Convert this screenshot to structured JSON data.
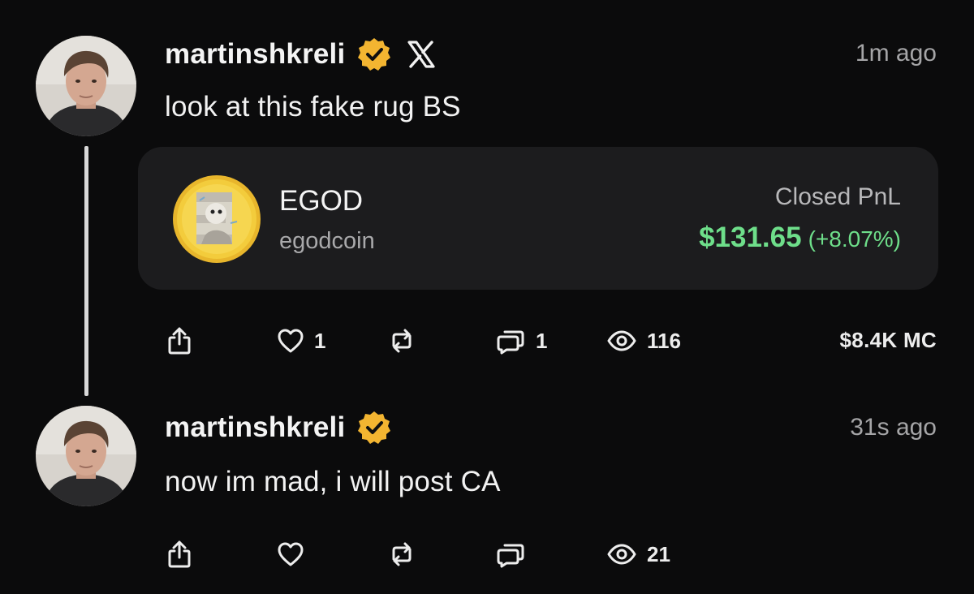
{
  "posts": [
    {
      "username": "martinshkreli",
      "verified": true,
      "source_icon": "x-logo-icon",
      "timestamp": "1m ago",
      "text": "look at this fake rug BS",
      "token_card": {
        "symbol": "EGOD",
        "name": "egodcoin",
        "pnl_label": "Closed PnL",
        "pnl_value": "$131.65",
        "pnl_change": "(+8.07%)",
        "pnl_color": "#6ede8a"
      },
      "actions": {
        "likes": "1",
        "comments": "1",
        "views": "116",
        "market_cap": "$8.4K  MC"
      }
    },
    {
      "username": "martinshkreli",
      "verified": true,
      "timestamp": "31s ago",
      "text": "now im mad, i will post CA",
      "actions": {
        "views": "21"
      }
    }
  ],
  "colors": {
    "background": "#0b0b0c",
    "card": "#1c1c1e",
    "verified_badge": "#f3b531",
    "positive": "#6ede8a"
  }
}
